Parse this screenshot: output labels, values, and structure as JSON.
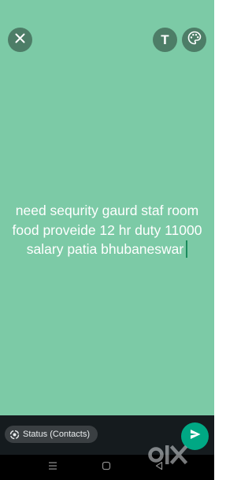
{
  "colors": {
    "background": "#7ccaa6",
    "bottom_bar": "#151b1e",
    "send_button": "#00a884",
    "cursor": "#1a8a5c"
  },
  "toolbar": {
    "close_icon": "close-icon",
    "text_tool_label": "T",
    "palette_icon": "palette-icon"
  },
  "status": {
    "text": "need sequrity gaurd staf room food proveide 12 hr duty 11000 salary patia bhubaneswar"
  },
  "footer": {
    "audience_label": "Status (Contacts)",
    "audience_icon": "status-ring-icon",
    "send_icon": "send-icon"
  },
  "navigation": {
    "items": [
      "recents-icon",
      "home-icon",
      "back-icon"
    ]
  },
  "watermark": {
    "text": "olx"
  }
}
